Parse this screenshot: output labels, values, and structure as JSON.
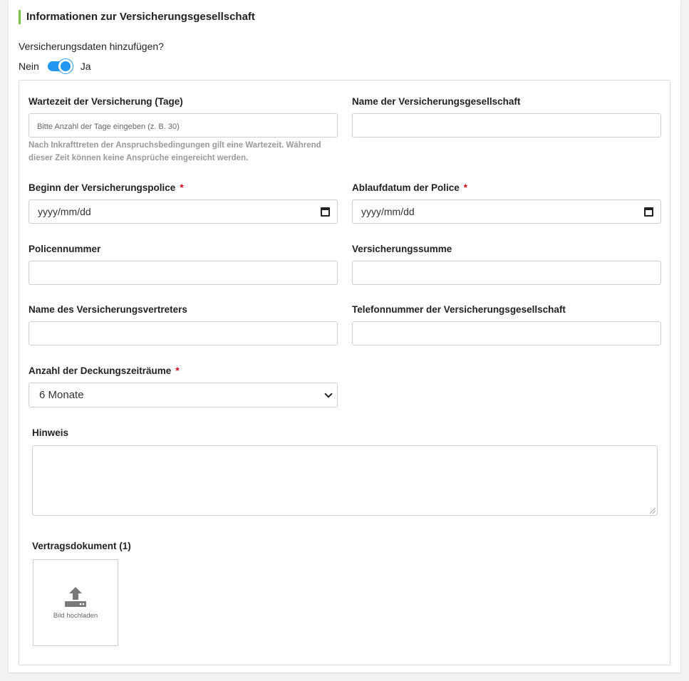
{
  "section": {
    "title": "Informationen zur Versicherungsgesellschaft"
  },
  "toggle": {
    "question": "Versicherungsdaten hinzufügen?",
    "off_label": "Nein",
    "on_label": "Ja",
    "state": "on"
  },
  "fields": {
    "waiting_period": {
      "label": "Wartezeit der Versicherung (Tage)",
      "placeholder": "Bitte Anzahl der Tage eingeben (z. B. 30)",
      "help": "Nach Inkrafttreten der Anspruchsbedingungen gilt eine Wartezeit. Während dieser Zeit können keine Ansprüche eingereicht werden."
    },
    "company_name": {
      "label": "Name der Versicherungsgesellschaft",
      "value": ""
    },
    "policy_start": {
      "label": "Beginn der Versicherungspolice",
      "required_mark": "*",
      "placeholder": "yyyy/mm/dd"
    },
    "policy_end": {
      "label": "Ablaufdatum der Police",
      "required_mark": "*",
      "placeholder": "yyyy/mm/dd"
    },
    "policy_number": {
      "label": "Policennummer",
      "value": ""
    },
    "sum_insured": {
      "label": "Versicherungssumme",
      "value": ""
    },
    "agent_name": {
      "label": "Name des Versicherungsvertreters",
      "value": ""
    },
    "company_phone": {
      "label": "Telefonnummer der Versicherungsgesellschaft",
      "value": ""
    },
    "coverage_periods": {
      "label": "Anzahl der Deckungszeiträume",
      "required_mark": "*",
      "selected": "6 Monate"
    },
    "note": {
      "label": "Hinweis",
      "value": ""
    },
    "contract_document": {
      "label": "Vertragsdokument (1)",
      "upload_label": "Bild hochladen",
      "upload_icon": "upload-icon"
    }
  },
  "colors": {
    "accent_bar": "#7cc242",
    "toggle": "#2196f3",
    "required": "#d0021b"
  }
}
